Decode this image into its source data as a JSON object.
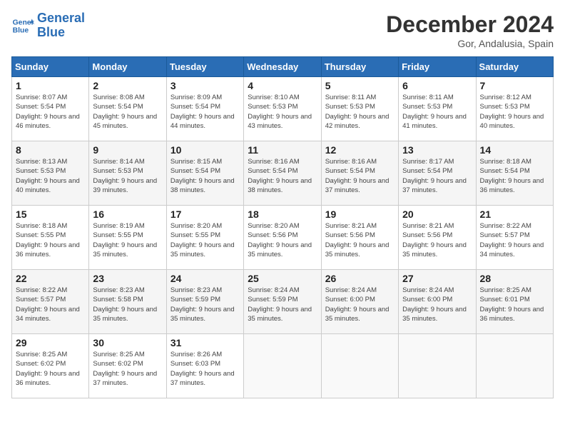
{
  "header": {
    "logo_line1": "General",
    "logo_line2": "Blue",
    "month_year": "December 2024",
    "location": "Gor, Andalusia, Spain"
  },
  "weekdays": [
    "Sunday",
    "Monday",
    "Tuesday",
    "Wednesday",
    "Thursday",
    "Friday",
    "Saturday"
  ],
  "weeks": [
    [
      {
        "day": 1,
        "sunrise": "8:07 AM",
        "sunset": "5:54 PM",
        "daylight": "9 hours and 46 minutes."
      },
      {
        "day": 2,
        "sunrise": "8:08 AM",
        "sunset": "5:54 PM",
        "daylight": "9 hours and 45 minutes."
      },
      {
        "day": 3,
        "sunrise": "8:09 AM",
        "sunset": "5:54 PM",
        "daylight": "9 hours and 44 minutes."
      },
      {
        "day": 4,
        "sunrise": "8:10 AM",
        "sunset": "5:53 PM",
        "daylight": "9 hours and 43 minutes."
      },
      {
        "day": 5,
        "sunrise": "8:11 AM",
        "sunset": "5:53 PM",
        "daylight": "9 hours and 42 minutes."
      },
      {
        "day": 6,
        "sunrise": "8:11 AM",
        "sunset": "5:53 PM",
        "daylight": "9 hours and 41 minutes."
      },
      {
        "day": 7,
        "sunrise": "8:12 AM",
        "sunset": "5:53 PM",
        "daylight": "9 hours and 40 minutes."
      }
    ],
    [
      {
        "day": 8,
        "sunrise": "8:13 AM",
        "sunset": "5:53 PM",
        "daylight": "9 hours and 40 minutes."
      },
      {
        "day": 9,
        "sunrise": "8:14 AM",
        "sunset": "5:53 PM",
        "daylight": "9 hours and 39 minutes."
      },
      {
        "day": 10,
        "sunrise": "8:15 AM",
        "sunset": "5:54 PM",
        "daylight": "9 hours and 38 minutes."
      },
      {
        "day": 11,
        "sunrise": "8:16 AM",
        "sunset": "5:54 PM",
        "daylight": "9 hours and 38 minutes."
      },
      {
        "day": 12,
        "sunrise": "8:16 AM",
        "sunset": "5:54 PM",
        "daylight": "9 hours and 37 minutes."
      },
      {
        "day": 13,
        "sunrise": "8:17 AM",
        "sunset": "5:54 PM",
        "daylight": "9 hours and 37 minutes."
      },
      {
        "day": 14,
        "sunrise": "8:18 AM",
        "sunset": "5:54 PM",
        "daylight": "9 hours and 36 minutes."
      }
    ],
    [
      {
        "day": 15,
        "sunrise": "8:18 AM",
        "sunset": "5:55 PM",
        "daylight": "9 hours and 36 minutes."
      },
      {
        "day": 16,
        "sunrise": "8:19 AM",
        "sunset": "5:55 PM",
        "daylight": "9 hours and 35 minutes."
      },
      {
        "day": 17,
        "sunrise": "8:20 AM",
        "sunset": "5:55 PM",
        "daylight": "9 hours and 35 minutes."
      },
      {
        "day": 18,
        "sunrise": "8:20 AM",
        "sunset": "5:56 PM",
        "daylight": "9 hours and 35 minutes."
      },
      {
        "day": 19,
        "sunrise": "8:21 AM",
        "sunset": "5:56 PM",
        "daylight": "9 hours and 35 minutes."
      },
      {
        "day": 20,
        "sunrise": "8:21 AM",
        "sunset": "5:56 PM",
        "daylight": "9 hours and 35 minutes."
      },
      {
        "day": 21,
        "sunrise": "8:22 AM",
        "sunset": "5:57 PM",
        "daylight": "9 hours and 34 minutes."
      }
    ],
    [
      {
        "day": 22,
        "sunrise": "8:22 AM",
        "sunset": "5:57 PM",
        "daylight": "9 hours and 34 minutes."
      },
      {
        "day": 23,
        "sunrise": "8:23 AM",
        "sunset": "5:58 PM",
        "daylight": "9 hours and 35 minutes."
      },
      {
        "day": 24,
        "sunrise": "8:23 AM",
        "sunset": "5:59 PM",
        "daylight": "9 hours and 35 minutes."
      },
      {
        "day": 25,
        "sunrise": "8:24 AM",
        "sunset": "5:59 PM",
        "daylight": "9 hours and 35 minutes."
      },
      {
        "day": 26,
        "sunrise": "8:24 AM",
        "sunset": "6:00 PM",
        "daylight": "9 hours and 35 minutes."
      },
      {
        "day": 27,
        "sunrise": "8:24 AM",
        "sunset": "6:00 PM",
        "daylight": "9 hours and 35 minutes."
      },
      {
        "day": 28,
        "sunrise": "8:25 AM",
        "sunset": "6:01 PM",
        "daylight": "9 hours and 36 minutes."
      }
    ],
    [
      {
        "day": 29,
        "sunrise": "8:25 AM",
        "sunset": "6:02 PM",
        "daylight": "9 hours and 36 minutes."
      },
      {
        "day": 30,
        "sunrise": "8:25 AM",
        "sunset": "6:02 PM",
        "daylight": "9 hours and 37 minutes."
      },
      {
        "day": 31,
        "sunrise": "8:26 AM",
        "sunset": "6:03 PM",
        "daylight": "9 hours and 37 minutes."
      },
      null,
      null,
      null,
      null
    ]
  ]
}
